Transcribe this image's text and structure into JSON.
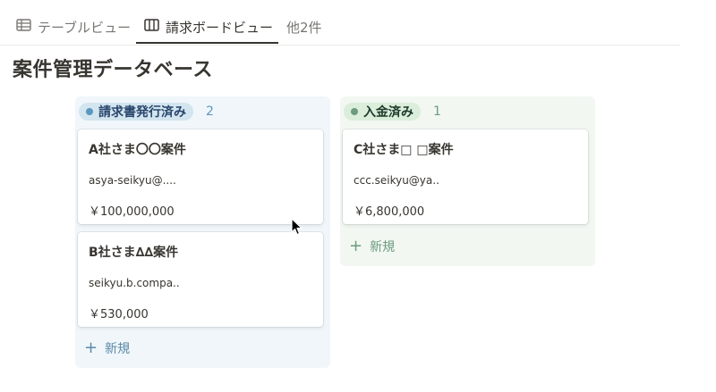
{
  "tabs": [
    {
      "label": "テーブルビュー",
      "icon": "table-icon"
    },
    {
      "label": "請求ボードビュー",
      "icon": "board-icon"
    },
    {
      "label": "他2件"
    }
  ],
  "page_title": "案件管理データベース",
  "columns": [
    {
      "label": "請求書発行済み",
      "count": "2",
      "color": "#5b97bd",
      "cards": [
        {
          "title": "A社さま〇〇案件",
          "email": "asya-seikyu@....",
          "amount": "￥100,000,000"
        },
        {
          "title": "B社さま∆∆案件",
          "email": "seikyu.b.compa..",
          "amount": "￥530,000"
        }
      ],
      "new_label": "新規"
    },
    {
      "label": "入金済み",
      "count": "1",
      "color": "#6c9b7d",
      "cards": [
        {
          "title": "C社さま□ □案件",
          "email": "ccc.seikyu@ya..",
          "amount": "￥6,800,000"
        }
      ],
      "new_label": "新規"
    }
  ]
}
